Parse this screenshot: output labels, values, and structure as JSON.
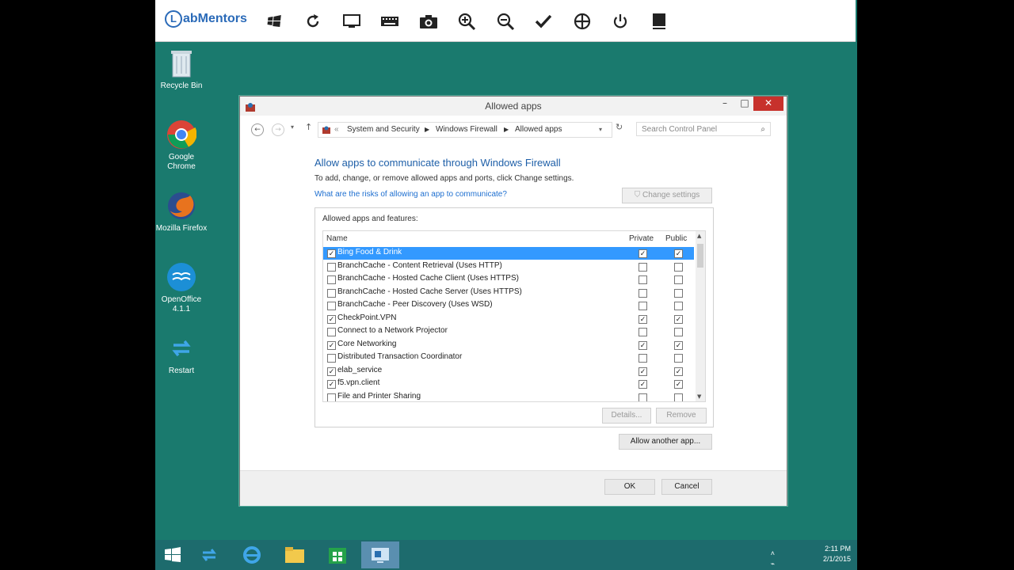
{
  "toolbar": {
    "logo_text": "abMentors",
    "logo_letter": "L",
    "icons": [
      "windows-key-icon",
      "refresh-icon",
      "monitor-icon",
      "keyboard-icon",
      "camera-icon",
      "zoom-in-icon",
      "zoom-out-icon",
      "checkmark-icon",
      "move-icon",
      "power-icon",
      "book-icon"
    ]
  },
  "desktop": {
    "icons": [
      {
        "label": "Recycle Bin"
      },
      {
        "label": "Google Chrome"
      },
      {
        "label": "Mozilla Firefox"
      },
      {
        "label": "OpenOffice 4.1.1"
      },
      {
        "label": "Restart"
      }
    ]
  },
  "window": {
    "title": "Allowed apps",
    "breadcrumb": [
      "System and Security",
      "Windows Firewall",
      "Allowed apps"
    ],
    "search_placeholder": "Search Control Panel",
    "heading": "Allow apps to communicate through Windows Firewall",
    "description": "To add, change, or remove allowed apps and ports, click Change settings.",
    "risk_link": "What are the risks of allowing an app to communicate?",
    "change_settings": "Change settings",
    "group_label": "Allowed apps and features:",
    "columns": {
      "name": "Name",
      "private": "Private",
      "public": "Public"
    },
    "apps": [
      {
        "name": "Bing Food & Drink",
        "enabled": true,
        "private": true,
        "public": true,
        "selected": true
      },
      {
        "name": "BranchCache - Content Retrieval (Uses HTTP)",
        "enabled": false,
        "private": false,
        "public": false
      },
      {
        "name": "BranchCache - Hosted Cache Client (Uses HTTPS)",
        "enabled": false,
        "private": false,
        "public": false
      },
      {
        "name": "BranchCache - Hosted Cache Server (Uses HTTPS)",
        "enabled": false,
        "private": false,
        "public": false
      },
      {
        "name": "BranchCache - Peer Discovery (Uses WSD)",
        "enabled": false,
        "private": false,
        "public": false
      },
      {
        "name": "CheckPoint.VPN",
        "enabled": true,
        "private": true,
        "public": true
      },
      {
        "name": "Connect to a Network Projector",
        "enabled": false,
        "private": false,
        "public": false
      },
      {
        "name": "Core Networking",
        "enabled": true,
        "private": true,
        "public": true
      },
      {
        "name": "Distributed Transaction Coordinator",
        "enabled": false,
        "private": false,
        "public": false
      },
      {
        "name": "elab_service",
        "enabled": true,
        "private": true,
        "public": true
      },
      {
        "name": "f5.vpn.client",
        "enabled": true,
        "private": true,
        "public": true
      },
      {
        "name": "File and Printer Sharing",
        "enabled": false,
        "private": false,
        "public": false
      }
    ],
    "details": "Details...",
    "remove": "Remove",
    "allow_another": "Allow another app...",
    "ok": "OK",
    "cancel": "Cancel"
  },
  "tray": {
    "time": "2:11 PM",
    "date": "2/1/2015"
  },
  "colors": {
    "desktop": "#1a7a6e",
    "taskbar": "#1d6b6d",
    "selection": "#3399ff",
    "heading": "#1e5fa8",
    "link": "#1e6fd0"
  }
}
